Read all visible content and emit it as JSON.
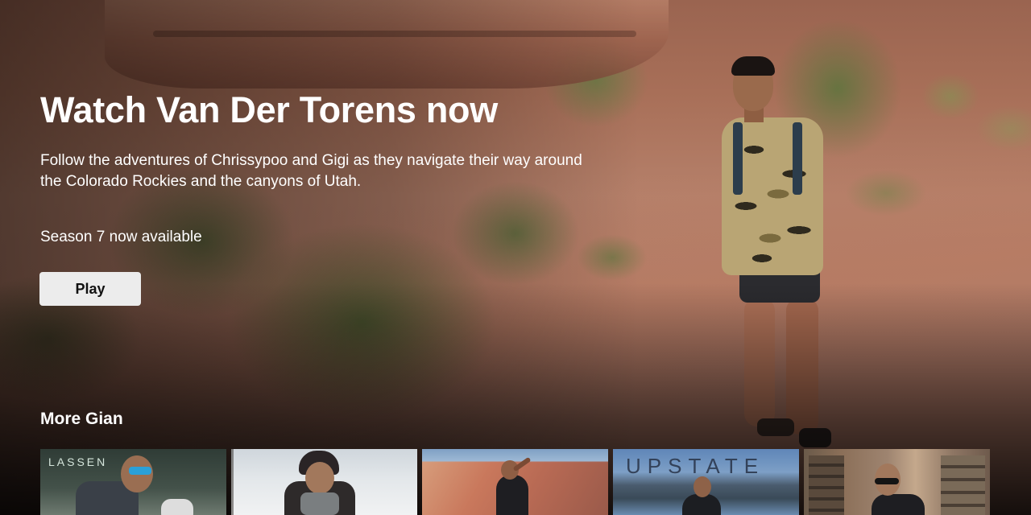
{
  "hero": {
    "title": "Watch Van Der Torens now",
    "description": "Follow the adventures of Chrissypoo and Gigi as they navigate their way around the Colorado Rockies and the canyons of Utah.",
    "season": "Season 7 now available",
    "play_label": "Play"
  },
  "row": {
    "title": "More Gian",
    "tiles": [
      {
        "label": "LASSEN"
      },
      {
        "label": ""
      },
      {
        "label": ""
      },
      {
        "label": "UPSTATE"
      },
      {
        "label": ""
      }
    ]
  },
  "colors": {
    "button_bg": "#ececec",
    "text": "#ffffff"
  }
}
